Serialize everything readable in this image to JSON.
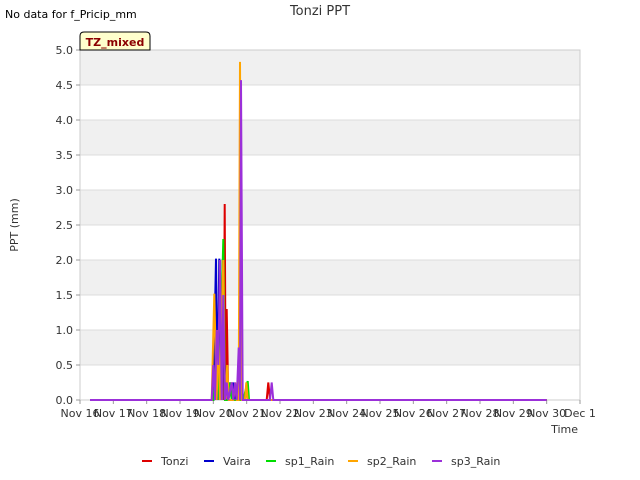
{
  "header": {
    "nodata": "No data for f_Pricip_mm",
    "badge": "TZ_mixed"
  },
  "chart_data": {
    "type": "line",
    "title": "Tonzi PPT",
    "xlabel": "Time",
    "ylabel": "PPT (mm)",
    "xlim": [
      "2014-11-16",
      "2014-12-01"
    ],
    "ylim": [
      0,
      5.0
    ],
    "x_ticks": [
      "Nov 16",
      "Nov 17",
      "Nov 18",
      "Nov 19",
      "Nov 20",
      "Nov 21",
      "Nov 22",
      "Nov 23",
      "Nov 24",
      "Nov 25",
      "Nov 26",
      "Nov 27",
      "Nov 28",
      "Nov 29",
      "Nov 30",
      "Dec 1"
    ],
    "y_ticks": [
      "0.0",
      "0.5",
      "1.0",
      "1.5",
      "2.0",
      "2.5",
      "3.0",
      "3.5",
      "4.0",
      "4.5",
      "5.0"
    ],
    "grid": "horizontal bands",
    "legend_position": "bottom",
    "series": [
      {
        "name": "Tonzi",
        "color": "#dd0000",
        "points": [
          [
            16.3,
            0
          ],
          [
            20.0,
            0
          ],
          [
            20.05,
            1.52
          ],
          [
            20.1,
            0
          ],
          [
            20.15,
            1.0
          ],
          [
            20.2,
            0
          ],
          [
            20.28,
            2.01
          ],
          [
            20.31,
            0
          ],
          [
            20.34,
            2.8
          ],
          [
            20.37,
            0
          ],
          [
            20.4,
            1.3
          ],
          [
            20.45,
            0
          ],
          [
            20.55,
            0.25
          ],
          [
            20.6,
            0
          ],
          [
            20.75,
            0
          ],
          [
            20.8,
            0.25
          ],
          [
            20.85,
            0
          ],
          [
            20.95,
            0
          ],
          [
            21.0,
            0.25
          ],
          [
            21.05,
            0
          ],
          [
            21.6,
            0
          ],
          [
            21.65,
            0.25
          ],
          [
            21.7,
            0
          ],
          [
            30.0,
            0
          ]
        ]
      },
      {
        "name": "Vaira",
        "color": "#0000cc",
        "points": [
          [
            16.3,
            0
          ],
          [
            20.0,
            0
          ],
          [
            20.08,
            2.02
          ],
          [
            20.12,
            0
          ],
          [
            20.18,
            2.02
          ],
          [
            20.22,
            0
          ],
          [
            20.29,
            2.03
          ],
          [
            20.33,
            0
          ],
          [
            20.4,
            0.25
          ],
          [
            20.45,
            0
          ],
          [
            20.5,
            0.25
          ],
          [
            20.55,
            0
          ],
          [
            20.6,
            0.25
          ],
          [
            20.66,
            0
          ],
          [
            30.0,
            0
          ]
        ]
      },
      {
        "name": "sp1_Rain",
        "color": "#00dd00",
        "points": [
          [
            16.3,
            0
          ],
          [
            20.0,
            0
          ],
          [
            20.08,
            0.5
          ],
          [
            20.13,
            0.75
          ],
          [
            20.18,
            0
          ],
          [
            20.3,
            2.3
          ],
          [
            20.35,
            0
          ],
          [
            20.45,
            0
          ],
          [
            20.5,
            0.25
          ],
          [
            20.55,
            0
          ],
          [
            20.9,
            0
          ],
          [
            21.03,
            0.27
          ],
          [
            21.07,
            0
          ],
          [
            30.0,
            0
          ]
        ]
      },
      {
        "name": "sp2_Rain",
        "color": "#ffa500",
        "points": [
          [
            16.3,
            0
          ],
          [
            19.95,
            0
          ],
          [
            20.03,
            1.52
          ],
          [
            20.1,
            0
          ],
          [
            20.15,
            1.0
          ],
          [
            20.2,
            0
          ],
          [
            20.3,
            2.0
          ],
          [
            20.34,
            0
          ],
          [
            20.42,
            0.5
          ],
          [
            20.46,
            0
          ],
          [
            20.6,
            0
          ],
          [
            20.66,
            0.25
          ],
          [
            20.7,
            0
          ],
          [
            20.76,
            0
          ],
          [
            20.8,
            4.83
          ],
          [
            20.85,
            0
          ],
          [
            20.95,
            0
          ],
          [
            20.99,
            0.25
          ],
          [
            21.03,
            0
          ],
          [
            30.0,
            0
          ]
        ]
      },
      {
        "name": "sp3_Rain",
        "color": "#9b30d9",
        "points": [
          [
            16.3,
            0
          ],
          [
            19.95,
            0
          ],
          [
            20.0,
            0.5
          ],
          [
            20.05,
            0
          ],
          [
            20.1,
            1.0
          ],
          [
            20.15,
            0.5
          ],
          [
            20.2,
            2.0
          ],
          [
            20.25,
            0
          ],
          [
            20.3,
            1.5
          ],
          [
            20.35,
            0
          ],
          [
            20.4,
            0.25
          ],
          [
            20.45,
            0
          ],
          [
            20.55,
            0.25
          ],
          [
            20.6,
            0
          ],
          [
            20.65,
            0.25
          ],
          [
            20.7,
            0
          ],
          [
            20.76,
            0.75
          ],
          [
            20.8,
            0
          ],
          [
            20.83,
            4.57
          ],
          [
            20.88,
            0
          ],
          [
            21.7,
            0
          ],
          [
            21.75,
            0.25
          ],
          [
            21.8,
            0
          ],
          [
            30.0,
            0
          ]
        ]
      }
    ]
  }
}
